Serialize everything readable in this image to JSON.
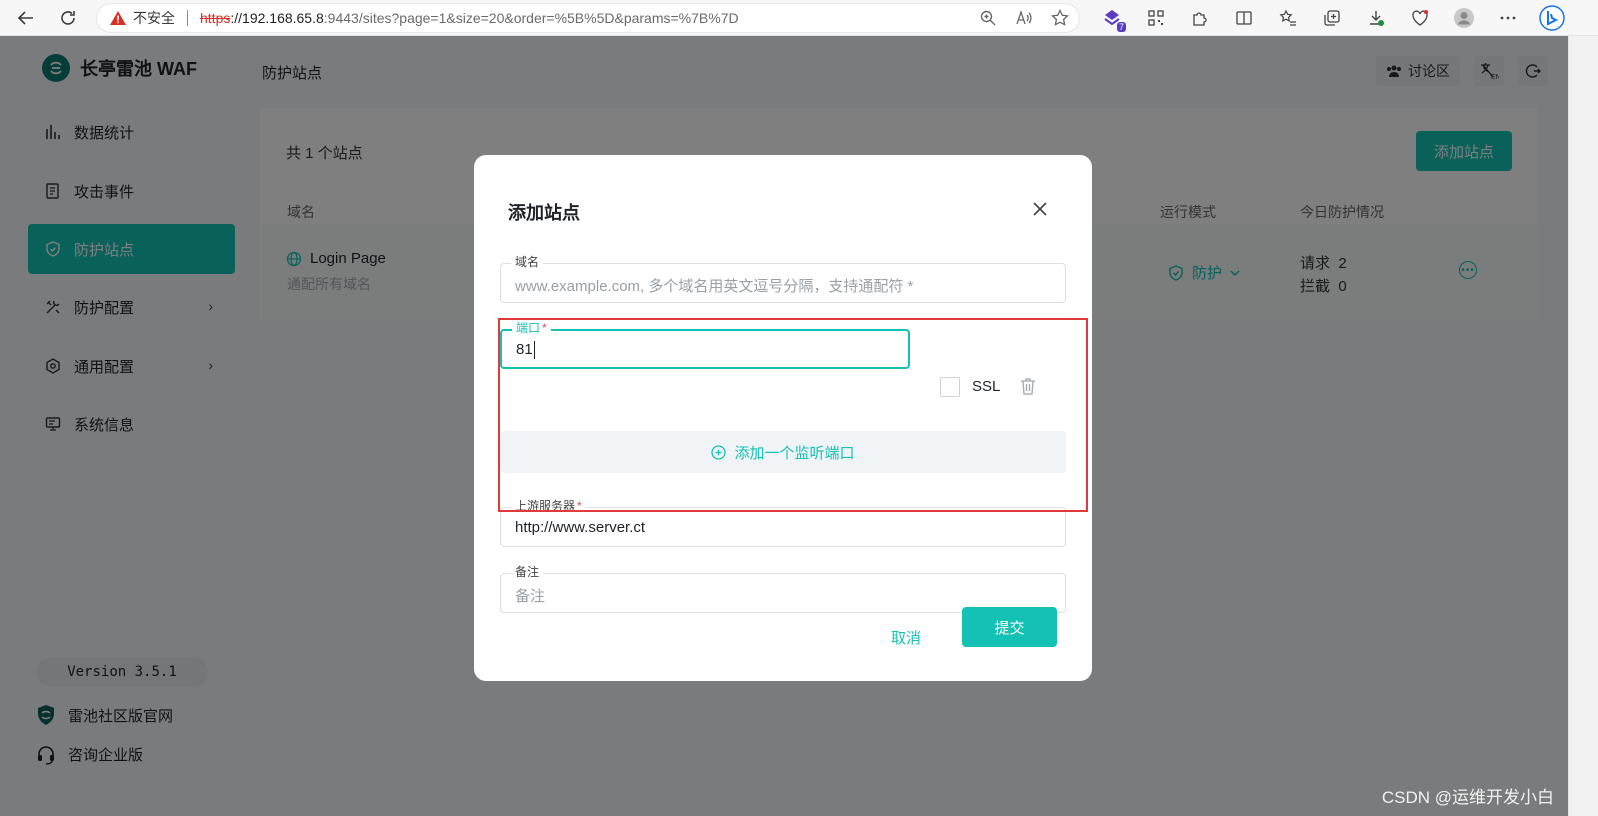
{
  "browser": {
    "insecure_label": "不安全",
    "url_scheme": "https",
    "url_host": "://192.168.65.8",
    "url_rest": ":9443/sites?page=1&size=20&order=%5B%5D&params=%7B%7D",
    "ext_badge": "7"
  },
  "app": {
    "logo_text": "长亭雷池 WAF",
    "page_title": "防护站点",
    "forum_label": "讨论区",
    "version": "Version 3.5.1",
    "accent": "#13c2b5"
  },
  "sidebar": {
    "items": [
      {
        "label": "数据统计",
        "icon": "bar-chart-icon"
      },
      {
        "label": "攻击事件",
        "icon": "event-log-icon"
      },
      {
        "label": "防护站点",
        "icon": "shield-icon",
        "active": true
      },
      {
        "label": "防护配置",
        "icon": "tools-icon"
      },
      {
        "label": "通用配置",
        "icon": "settings-icon"
      },
      {
        "label": "系统信息",
        "icon": "monitor-icon"
      }
    ],
    "links": [
      {
        "label": "雷池社区版官网",
        "icon": "shield-logo-icon"
      },
      {
        "label": "咨询企业版",
        "icon": "headset-icon"
      }
    ]
  },
  "sites": {
    "count_text": "共 1 个站点",
    "add_button": "添加站点",
    "columns": [
      "域名",
      "运行模式",
      "今日防护情况"
    ],
    "rows": [
      {
        "domain": "Login Page",
        "subtitle": "通配所有域名",
        "mode": "防护",
        "requests_label": "请求",
        "requests": "2",
        "blocked_label": "拦截",
        "blocked": "0"
      }
    ]
  },
  "modal": {
    "title": "添加站点",
    "domain_label": "域名",
    "domain_placeholder": "www.example.com, 多个域名用英文逗号分隔，支持通配符 *",
    "port_label": "端口",
    "port_value": "81",
    "ssl_label": "SSL",
    "add_port_label": "添加一个监听端口",
    "upstream_label": "上游服务器",
    "upstream_value": "http://www.server.ct",
    "note_label": "备注",
    "note_placeholder": "备注",
    "cancel_label": "取消",
    "submit_label": "提交"
  },
  "watermark": "CSDN @运维开发小白"
}
